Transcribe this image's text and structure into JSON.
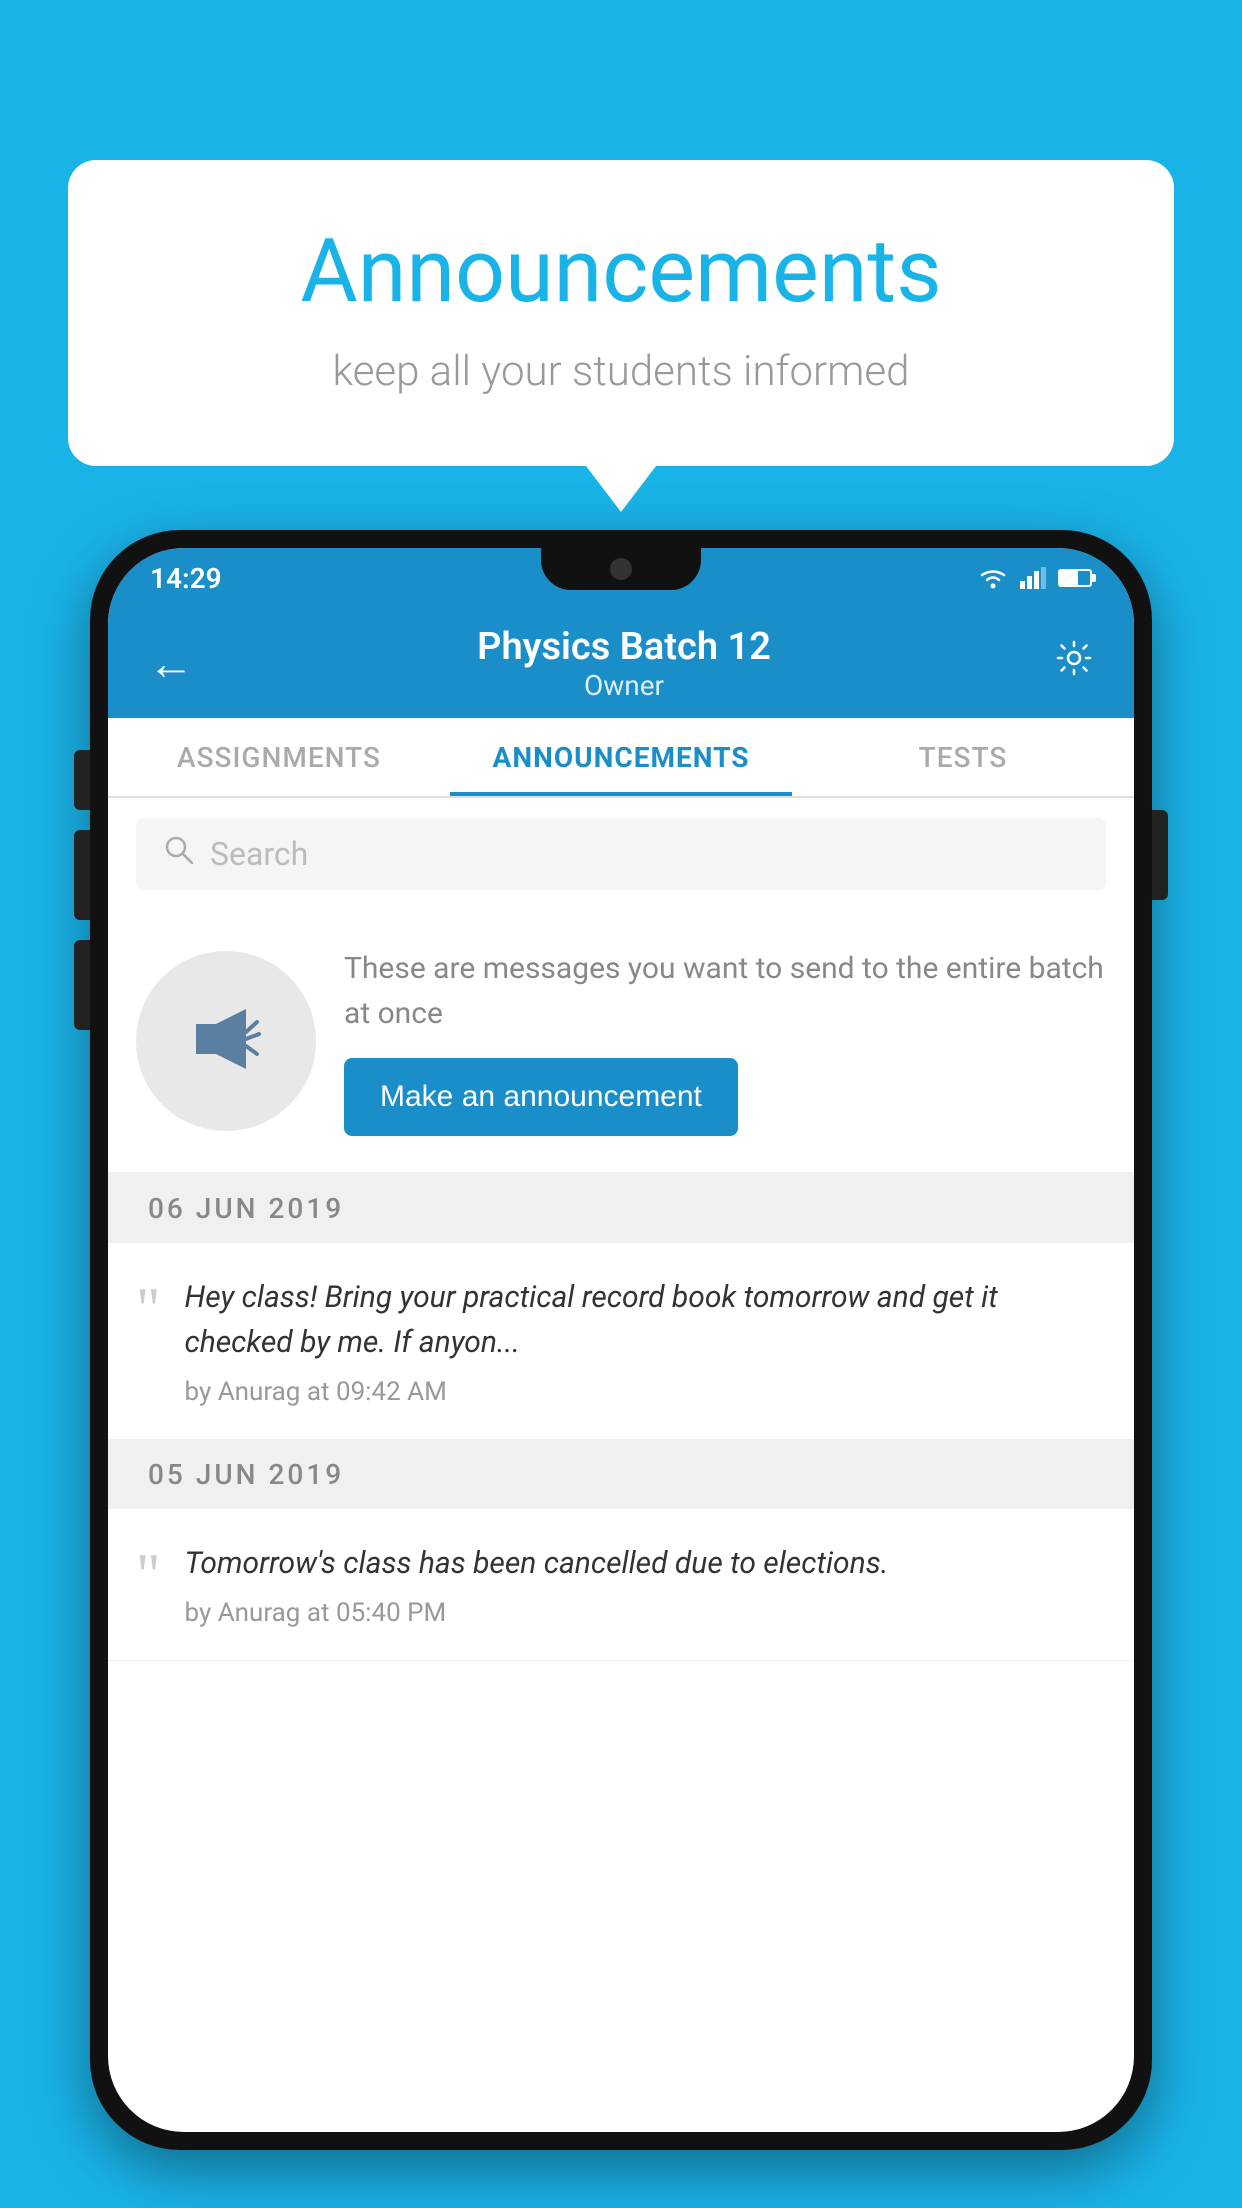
{
  "background_color": "#1ab3e8",
  "speech_bubble": {
    "title": "Announcements",
    "subtitle": "keep all your students informed"
  },
  "phone": {
    "status_bar": {
      "time": "14:29"
    },
    "header": {
      "title": "Physics Batch 12",
      "subtitle": "Owner",
      "back_label": "←",
      "settings_label": "⚙"
    },
    "tabs": [
      {
        "label": "ASSIGNMENTS",
        "active": false
      },
      {
        "label": "ANNOUNCEMENTS",
        "active": true
      },
      {
        "label": "TESTS",
        "active": false
      }
    ],
    "search": {
      "placeholder": "Search"
    },
    "promo": {
      "description": "These are messages you want to send to the entire batch at once",
      "button_label": "Make an announcement"
    },
    "announcements": [
      {
        "date": "06  JUN  2019",
        "text": "Hey class! Bring your practical record book tomorrow and get it checked by me. If anyon...",
        "meta": "by Anurag at 09:42 AM"
      },
      {
        "date": "05  JUN  2019",
        "text": "Tomorrow's class has been cancelled due to elections.",
        "meta": "by Anurag at 05:40 PM"
      }
    ]
  }
}
